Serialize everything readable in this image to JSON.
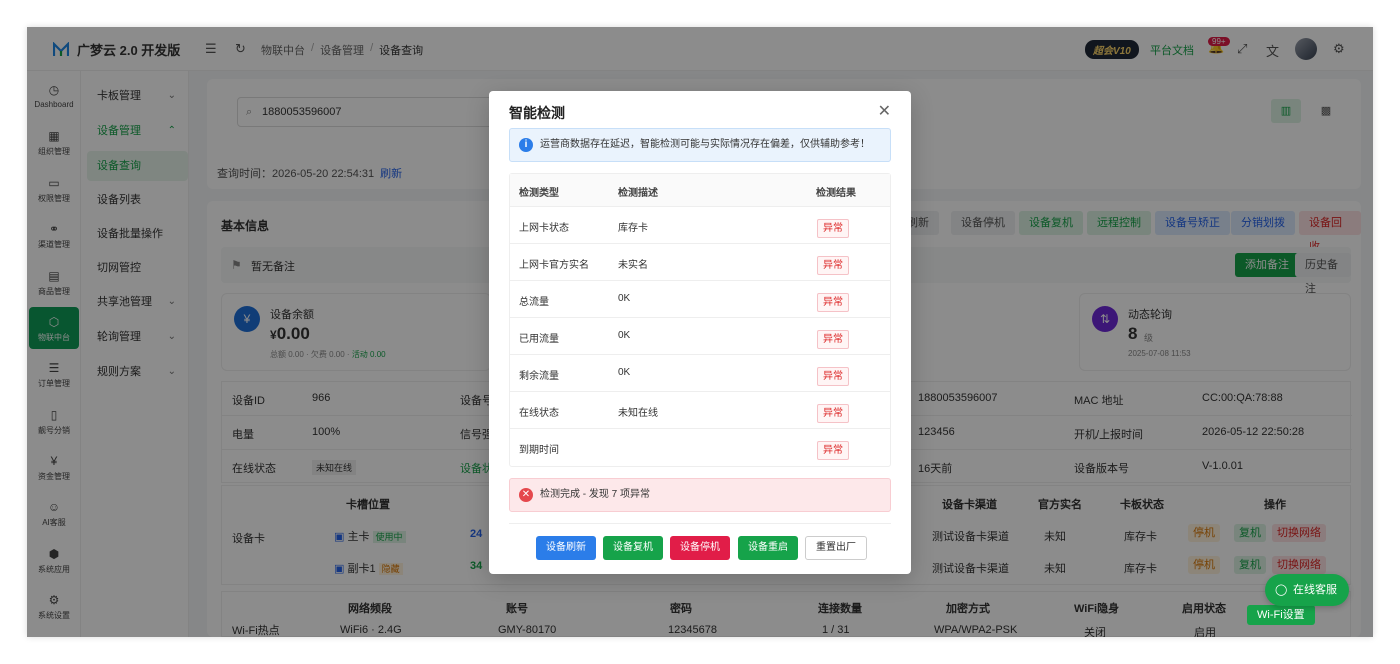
{
  "app": {
    "title": "广梦云 2.0 开发版"
  },
  "header": {
    "breadcrumb": [
      "物联中台",
      "设备管理",
      "设备查询"
    ],
    "vip_badge": "超会V10",
    "docs_link": "平台文档",
    "notif_count": "99+"
  },
  "leftnav": [
    "Dashboard",
    "组织管理",
    "权限管理",
    "渠道管理",
    "商品管理",
    "物联中台",
    "订单管理",
    "靓号分销",
    "资金管理",
    "AI客服",
    "系统应用",
    "系统设置"
  ],
  "subnav": [
    {
      "label": "卡板管理",
      "chev": "⌄"
    },
    {
      "label": "设备管理",
      "chev": "⌃"
    },
    {
      "label": "设备查询",
      "chev": ""
    },
    {
      "label": "设备列表",
      "chev": ""
    },
    {
      "label": "设备批量操作",
      "chev": ""
    },
    {
      "label": "切网管控",
      "chev": ""
    },
    {
      "label": "共享池管理",
      "chev": "⌄"
    },
    {
      "label": "轮询管理",
      "chev": "⌄"
    },
    {
      "label": "规则方案",
      "chev": "⌄"
    }
  ],
  "search": {
    "value": "1880053596007"
  },
  "query_time": {
    "label": "查询时间：2026-05-20 22:54:31",
    "refresh": "刷新"
  },
  "basic_info": {
    "title": "基本信息",
    "actions": [
      "刷新",
      "设备停机",
      "设备复机",
      "远程控制",
      "设备号矫正",
      "分销划拨",
      "设备回收"
    ],
    "note": "暂无备注",
    "add_note": "添加备注",
    "history_note": "历史备注"
  },
  "balance": {
    "label": "设备余额",
    "currency": "¥",
    "value": "0.00",
    "sub": "总额 0.00 · 欠费 0.00 · ",
    "activity": "活动 0.00"
  },
  "polling": {
    "label": "动态轮询",
    "value": "8",
    "unit": "级",
    "date": "2025-07-08 11:53"
  },
  "info_rows": [
    [
      "设备ID",
      "966",
      "设备号",
      "1880053596007",
      "MAC 地址",
      "CC:00:QA:78:88"
    ],
    [
      "电量",
      "100%",
      "信号强度",
      "123456",
      "开机/上报时间",
      "2026-05-12 22:50:28"
    ],
    [
      "在线状态",
      "未知在线",
      "设备状态",
      "16天前",
      "设备版本号",
      "V-1.0.01"
    ]
  ],
  "sim_section": {
    "title": "设备卡",
    "headers": [
      "卡槽位置",
      "设备卡渠道",
      "官方实名",
      "卡板状态",
      "操作"
    ],
    "rows": [
      {
        "slot": "主卡",
        "tag": "使用中",
        "id": "24",
        "channel": "测试设备卡渠道",
        "realname": "未知",
        "status": "库存卡"
      },
      {
        "slot": "副卡1",
        "tag": "隐藏",
        "id": "34",
        "channel": "测试设备卡渠道",
        "realname": "未知",
        "status": "库存卡"
      }
    ],
    "ops": [
      "停机",
      "复机",
      "切换网络"
    ]
  },
  "wifi_section": {
    "title": "Wi-Fi热点",
    "headers": [
      "网络频段",
      "账号",
      "密码",
      "连接数量",
      "加密方式",
      "WiFi隐身",
      "启用状态"
    ],
    "row": [
      "WiFi6 · 2.4G",
      "GMY-80170",
      "12345678",
      "1 / 31",
      "WPA/WPA2-PSK",
      "关闭",
      "启用"
    ],
    "btn": "Wi-Fi设置"
  },
  "dialog": {
    "title": "智能检测",
    "notice": "运营商数据存在延迟，智能检测可能与实际情况存在偏差，仅供辅助参考！",
    "headers": [
      "检测类型",
      "检测描述",
      "检测结果"
    ],
    "rows": [
      {
        "type": "上网卡状态",
        "desc": "库存卡",
        "result": "异常"
      },
      {
        "type": "上网卡官方实名",
        "desc": "未实名",
        "result": "异常"
      },
      {
        "type": "总流量",
        "desc": "0K",
        "result": "异常"
      },
      {
        "type": "已用流量",
        "desc": "0K",
        "result": "异常"
      },
      {
        "type": "剩余流量",
        "desc": "0K",
        "result": "异常"
      },
      {
        "type": "在线状态",
        "desc": "未知在线",
        "result": "异常"
      },
      {
        "type": "到期时间",
        "desc": "",
        "result": "异常"
      }
    ],
    "summary": "检测完成 - 发现 7 项异常",
    "buttons": [
      "设备刷新",
      "设备复机",
      "设备停机",
      "设备重启",
      "重置出厂"
    ]
  },
  "float_service": "在线客服",
  "colors": {
    "green": "#16a34a",
    "blue": "#2b7de9",
    "red": "#e11d48",
    "overlay": "rgba(0,0,0,0.45)"
  }
}
